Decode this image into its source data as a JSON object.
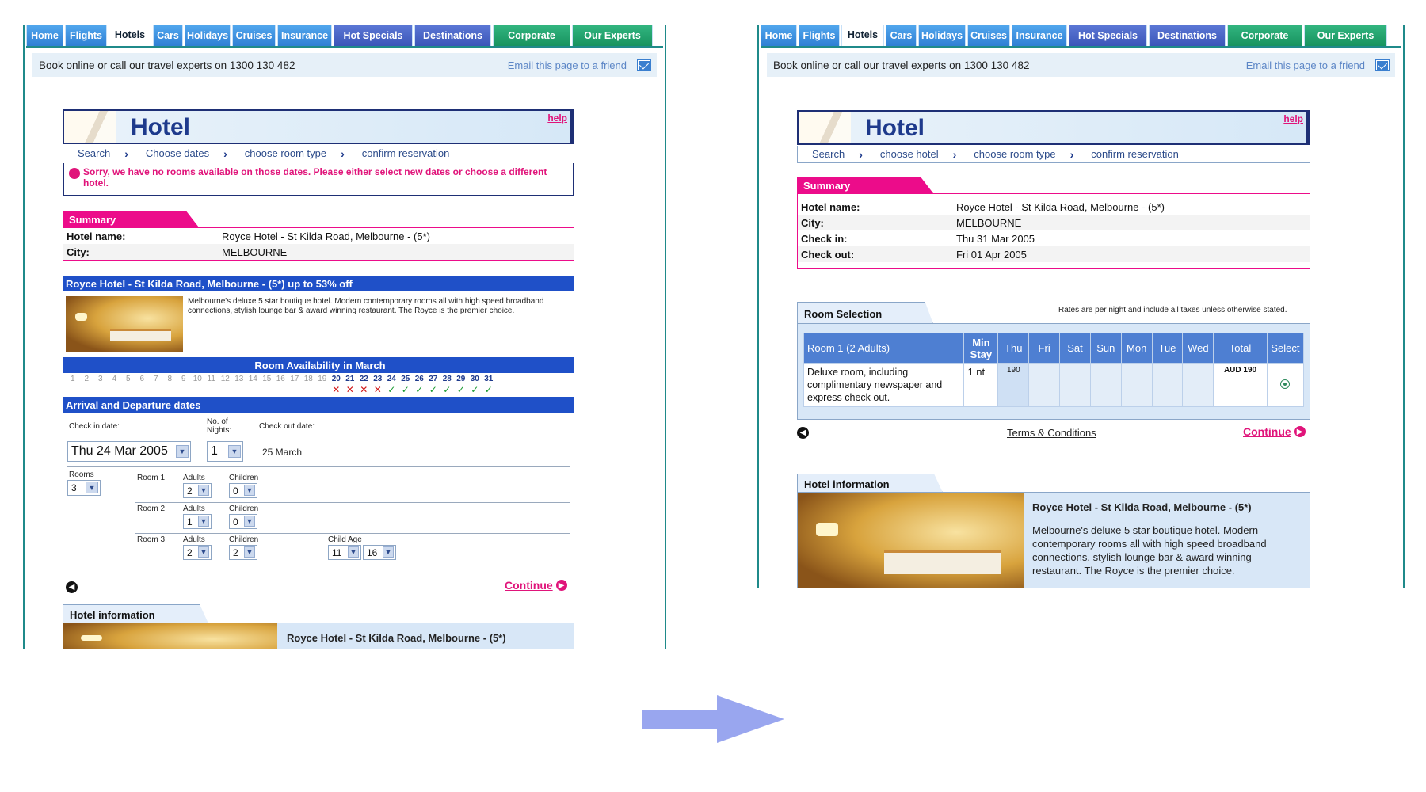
{
  "nav": {
    "tabs": [
      "Home",
      "Flights",
      "Hotels",
      "Cars",
      "Holidays",
      "Cruises",
      "Insurance",
      "Hot Specials",
      "Destinations",
      "Corporate",
      "Our Experts"
    ],
    "active": "Hotels"
  },
  "bookbar": {
    "text": "Book online or call our travel experts on 1300 130 482",
    "email": "Email this page to a friend"
  },
  "header": {
    "title": "Hotel",
    "help": "help"
  },
  "left": {
    "steps": [
      "Search",
      "Choose dates",
      "choose room type",
      "confirm reservation"
    ],
    "error": "Sorry, we have no rooms available on those dates. Please either select new dates or choose a different hotel.",
    "summary_title": "Summary",
    "summary": [
      {
        "k": "Hotel name:",
        "v": "Royce Hotel - St Kilda Road, Melbourne - (5*)"
      },
      {
        "k": "City:",
        "v": "MELBOURNE"
      }
    ],
    "deal_title": "Royce Hotel - St Kilda Road, Melbourne - (5*) up to 53% off",
    "deal_desc": "Melbourne's deluxe 5 star boutique hotel. Modern contemporary rooms all with high speed broadband connections, stylish lounge bar & award winning restaurant. The Royce is the premier choice.",
    "availability_title": "Room Availability in March",
    "days": [
      "1",
      "2",
      "3",
      "4",
      "5",
      "6",
      "7",
      "8",
      "9",
      "10",
      "11",
      "12",
      "13",
      "14",
      "15",
      "16",
      "17",
      "18",
      "19",
      "20",
      "21",
      "22",
      "23",
      "24",
      "25",
      "26",
      "27",
      "28",
      "29",
      "30",
      "31"
    ],
    "marks": [
      "",
      "",
      "",
      "",
      "",
      "",
      "",
      "",
      "",
      "",
      "",
      "",
      "",
      "",
      "",
      "",
      "",
      "",
      "",
      "✕",
      "✕",
      "✕",
      "✕",
      "✓",
      "✓",
      "✓",
      "✓",
      "✓",
      "✓",
      "✓",
      "✓"
    ],
    "dates_title": "Arrival and Departure dates",
    "checkin_label": "Check in date:",
    "nights_label": "No. of Nights:",
    "checkout_label": "Check out date:",
    "checkin_value": "Thu 24 Mar 2005",
    "nights_value": "1",
    "checkout_value": "25 March",
    "rooms_label": "Rooms",
    "rooms_value": "3",
    "rooms": [
      {
        "name": "Room 1",
        "adults": "2",
        "children": "0"
      },
      {
        "name": "Room 2",
        "adults": "1",
        "children": "0"
      },
      {
        "name": "Room 3",
        "adults": "2",
        "children": "2",
        "child_ages": [
          "11",
          "16"
        ]
      }
    ],
    "adults_label": "Adults",
    "children_label": "Children",
    "child_age_label": "Child Age",
    "continue": "Continue",
    "info_title": "Hotel information",
    "info_hotel": "Royce Hotel - St Kilda Road, Melbourne - (5*)"
  },
  "right": {
    "steps": [
      "Search",
      "choose hotel",
      "choose room type",
      "confirm reservation"
    ],
    "summary_title": "Summary",
    "summary": [
      {
        "k": "Hotel name:",
        "v": "Royce Hotel - St Kilda Road, Melbourne - (5*)"
      },
      {
        "k": "City:",
        "v": "MELBOURNE"
      },
      {
        "k": "Check in:",
        "v": "Thu 31 Mar 2005"
      },
      {
        "k": "Check out:",
        "v": "Fri 01 Apr 2005"
      }
    ],
    "room_selection_title": "Room Selection",
    "rates_note": "Rates are per night and include all taxes unless otherwise stated.",
    "columns": [
      "Room 1 (2 Adults)",
      "Min Stay",
      "Thu",
      "Fri",
      "Sat",
      "Sun",
      "Mon",
      "Tue",
      "Wed",
      "Total",
      "Select"
    ],
    "row": {
      "room": "Deluxe room, including complimentary newspaper and express check out.",
      "min_stay": "1 nt",
      "thu": "190",
      "total": "AUD 190"
    },
    "terms": "Terms & Conditions",
    "continue": "Continue",
    "info_title": "Hotel information",
    "info_hotel": "Royce Hotel - St Kilda Road, Melbourne - (5*)",
    "info_desc": "Melbourne's deluxe 5 star boutique hotel. Modern contemporary rooms all with high speed broadband connections, stylish lounge bar & award winning restaurant. The Royce is the premier choice."
  },
  "colors": {
    "accent_pink": "#ec0c8a",
    "bar_blue": "#1f50c8",
    "frame_teal": "#1f8a8a",
    "arrow": "#99a6ef"
  }
}
